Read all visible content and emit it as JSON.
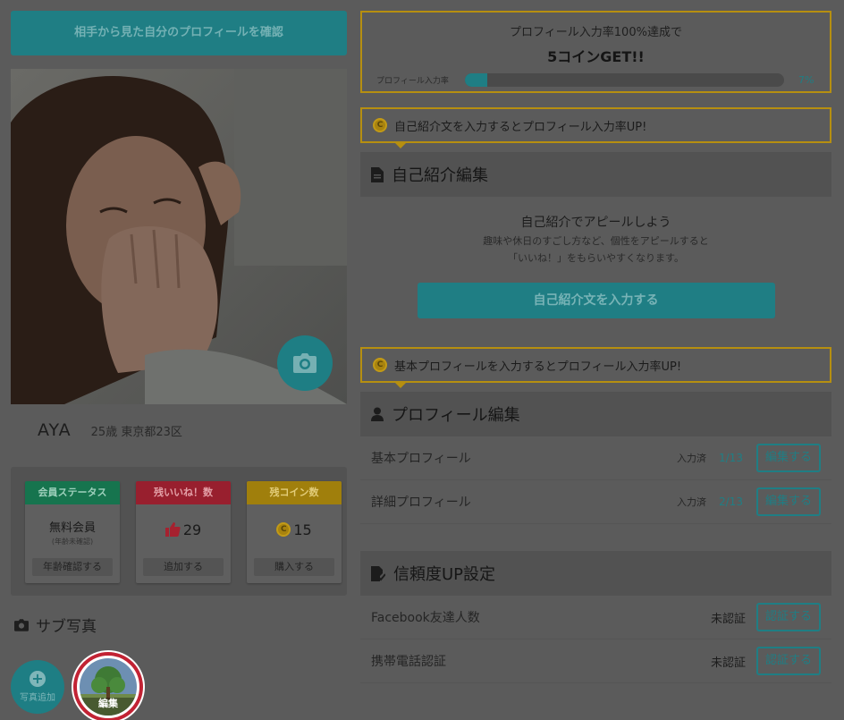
{
  "left": {
    "view_profile_button": "相手から見た自分のプロフィールを確認",
    "profile": {
      "name": "AYA",
      "meta": "25歳 東京都23区"
    },
    "stats": [
      {
        "header": "会員ステータス",
        "value": "無料会員",
        "sub": "(年齢未確認)",
        "action": "年齢確認する"
      },
      {
        "header": "残いいね！数",
        "value": "29",
        "action": "追加する"
      },
      {
        "header": "残コイン数",
        "value": "15",
        "action": "購入する"
      }
    ],
    "sub_photos": {
      "title": "サブ写真",
      "add_label": "写真追加",
      "edit_label": "編集"
    }
  },
  "right": {
    "goal": {
      "line1": "プロフィール入力率100%達成で",
      "line2": "5コインGET!!",
      "progress_label": "プロフィール入力率",
      "progress_pct": "7%",
      "progress_value": 7
    },
    "tip1": "自己紹介文を入力するとプロフィール入力率UP!",
    "self_intro": {
      "title": "自己紹介編集",
      "heading": "自己紹介でアピールしよう",
      "desc1": "趣味や休日のすごし方など、個性をアピールすると",
      "desc2": "「いいね！」をもらいやすくなります。",
      "button": "自己紹介文を入力する"
    },
    "tip2": "基本プロフィールを入力するとプロフィール入力率UP!",
    "profile_edit": {
      "title": "プロフィール編集",
      "rows": [
        {
          "label": "基本プロフィール",
          "status": "入力済",
          "count": "1/13",
          "action": "編集する"
        },
        {
          "label": "詳細プロフィール",
          "status": "入力済",
          "count": "2/13",
          "action": "編集する"
        }
      ]
    },
    "trust": {
      "title": "信頼度UP設定",
      "rows": [
        {
          "label": "Facebook友達人数",
          "status": "未認証",
          "action": "認証する"
        },
        {
          "label": "携帯電話認証",
          "status": "未認証",
          "action": "認証する"
        }
      ]
    }
  },
  "colors": {
    "teal": "#1f7e84",
    "gold": "#b68f10",
    "red": "#c22334",
    "green": "#16744e"
  }
}
